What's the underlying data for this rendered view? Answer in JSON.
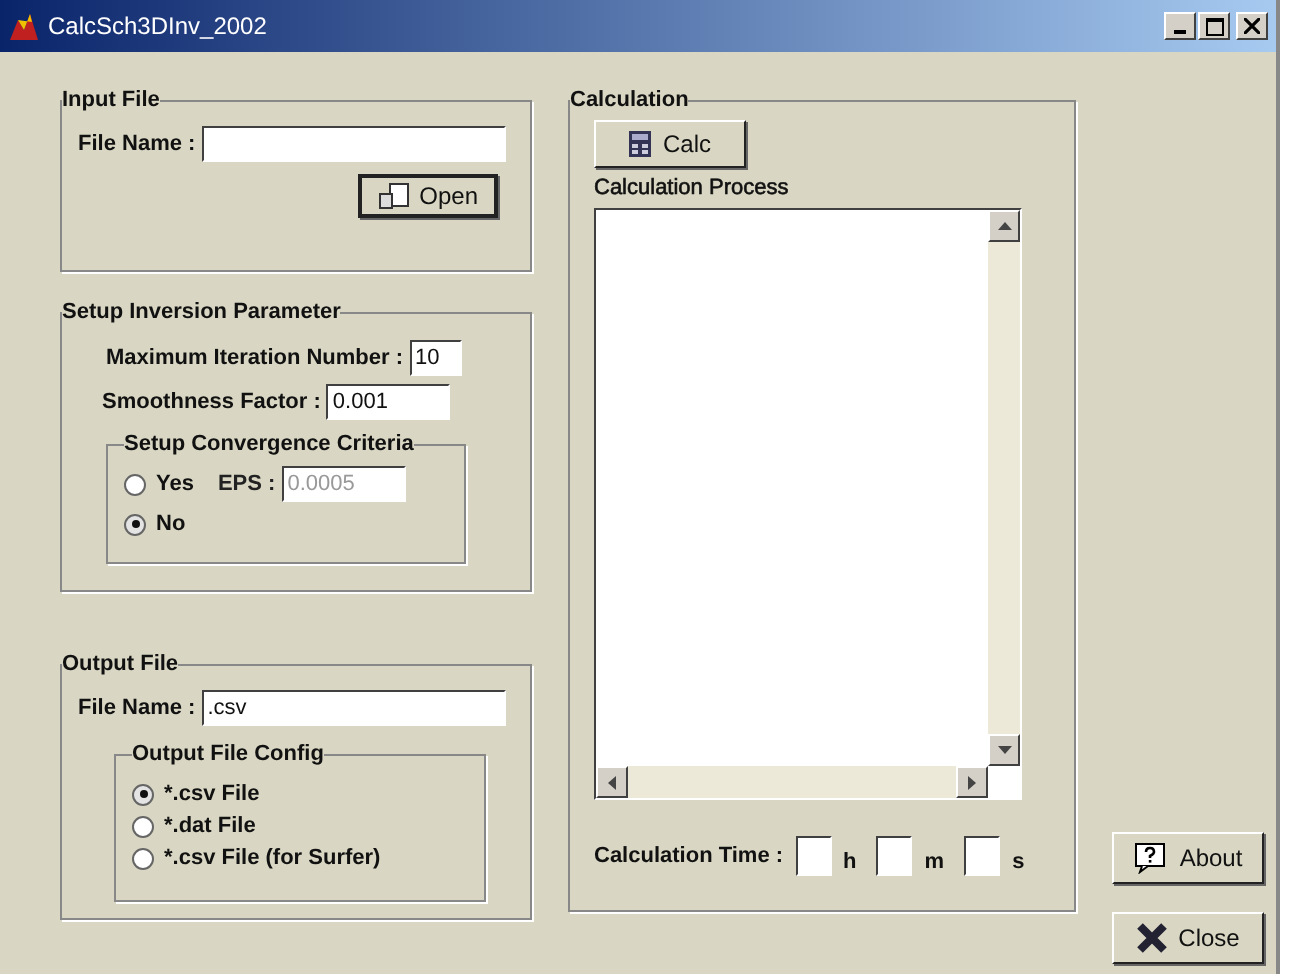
{
  "window": {
    "title": "CalcSch3DInv_2002"
  },
  "input_file": {
    "title": "Input File",
    "file_name_label": "File Name :",
    "open_button": "Open"
  },
  "inversion": {
    "title": "Setup Inversion Parameter",
    "fields": [
      {
        "label": "Maximum Iteration Number :",
        "value": "10"
      },
      {
        "label": "Smoothness Factor :",
        "value": "0.001"
      }
    ],
    "convergence": {
      "title": "Setup Convergence Criteria",
      "options": [
        {
          "label": "Yes",
          "selected": false
        },
        {
          "label": "No",
          "selected": true
        }
      ],
      "eps": {
        "label": "EPS :",
        "value": "0.0005",
        "disabled": true
      }
    }
  },
  "output_file": {
    "title": "Output File",
    "file_name_label": "File Name :",
    "file_name": ".csv",
    "config": {
      "title": "Output File Config",
      "options": [
        {
          "label": "*.csv File",
          "selected": true
        },
        {
          "label": "*.dat File",
          "selected": false
        },
        {
          "label": "*.csv File (for Surfer)",
          "selected": false
        }
      ]
    }
  },
  "calculation": {
    "title": "Calculation",
    "calc_button": "Calc",
    "process_label": "Calculation Process",
    "time_label": "Calculation Time :",
    "time_units": [
      "h",
      "m",
      "s"
    ]
  },
  "buttons": [
    {
      "label": "About",
      "kind": "about"
    },
    {
      "label": "Close",
      "kind": "close"
    }
  ]
}
